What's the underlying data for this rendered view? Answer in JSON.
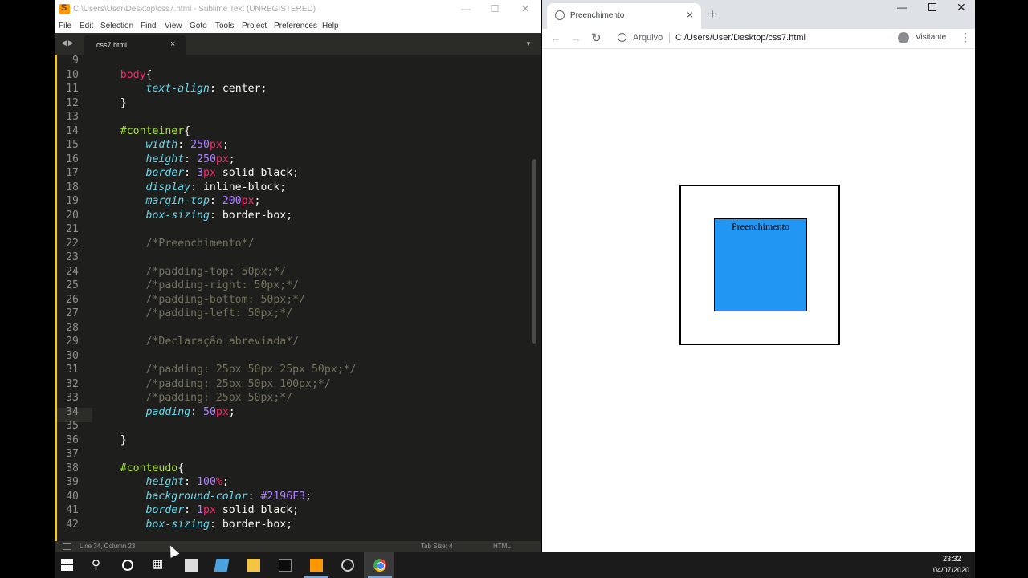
{
  "sublime": {
    "title": "C:\\Users\\User\\Desktop\\css7.html - Sublime Text (UNREGISTERED)",
    "menu": [
      "File",
      "Edit",
      "Selection",
      "Find",
      "View",
      "Goto",
      "Tools",
      "Project",
      "Preferences",
      "Help"
    ],
    "tab": {
      "label": "css7.html",
      "close": "×"
    },
    "status": {
      "position": "Line 34, Column 23",
      "tab_size": "Tab Size: 4",
      "syntax": "HTML"
    },
    "code": [
      {
        "n": "9",
        "parts": []
      },
      {
        "n": "10",
        "parts": [
          {
            "t": "    ",
            "c": ""
          },
          {
            "t": "body",
            "c": "tag"
          },
          {
            "t": "{",
            "c": ""
          }
        ]
      },
      {
        "n": "11",
        "parts": [
          {
            "t": "        ",
            "c": ""
          },
          {
            "t": "text-align",
            "c": "prop"
          },
          {
            "t": ": center;",
            "c": ""
          }
        ]
      },
      {
        "n": "12",
        "parts": [
          {
            "t": "    }",
            "c": ""
          }
        ]
      },
      {
        "n": "13",
        "parts": []
      },
      {
        "n": "14",
        "parts": [
          {
            "t": "    ",
            "c": ""
          },
          {
            "t": "#conteiner",
            "c": "sel"
          },
          {
            "t": "{",
            "c": ""
          }
        ]
      },
      {
        "n": "15",
        "parts": [
          {
            "t": "        ",
            "c": ""
          },
          {
            "t": "width",
            "c": "prop"
          },
          {
            "t": ": ",
            "c": ""
          },
          {
            "t": "250",
            "c": "num"
          },
          {
            "t": "px",
            "c": "unit"
          },
          {
            "t": ";",
            "c": ""
          }
        ]
      },
      {
        "n": "16",
        "parts": [
          {
            "t": "        ",
            "c": ""
          },
          {
            "t": "height",
            "c": "prop"
          },
          {
            "t": ": ",
            "c": ""
          },
          {
            "t": "250",
            "c": "num"
          },
          {
            "t": "px",
            "c": "unit"
          },
          {
            "t": ";",
            "c": ""
          }
        ]
      },
      {
        "n": "17",
        "parts": [
          {
            "t": "        ",
            "c": ""
          },
          {
            "t": "border",
            "c": "prop"
          },
          {
            "t": ": ",
            "c": ""
          },
          {
            "t": "3",
            "c": "num"
          },
          {
            "t": "px",
            "c": "unit"
          },
          {
            "t": " solid black;",
            "c": ""
          }
        ]
      },
      {
        "n": "18",
        "parts": [
          {
            "t": "        ",
            "c": ""
          },
          {
            "t": "display",
            "c": "prop"
          },
          {
            "t": ": inline-block;",
            "c": ""
          }
        ]
      },
      {
        "n": "19",
        "parts": [
          {
            "t": "        ",
            "c": ""
          },
          {
            "t": "margin-top",
            "c": "prop"
          },
          {
            "t": ": ",
            "c": ""
          },
          {
            "t": "200",
            "c": "num"
          },
          {
            "t": "px",
            "c": "unit"
          },
          {
            "t": ";",
            "c": ""
          }
        ]
      },
      {
        "n": "20",
        "parts": [
          {
            "t": "        ",
            "c": ""
          },
          {
            "t": "box-sizing",
            "c": "prop"
          },
          {
            "t": ": border-box;",
            "c": ""
          }
        ]
      },
      {
        "n": "21",
        "parts": []
      },
      {
        "n": "22",
        "parts": [
          {
            "t": "        ",
            "c": ""
          },
          {
            "t": "/*Preenchimento*/",
            "c": "cmt"
          }
        ]
      },
      {
        "n": "23",
        "parts": []
      },
      {
        "n": "24",
        "parts": [
          {
            "t": "        ",
            "c": ""
          },
          {
            "t": "/*padding-top: 50px;*/",
            "c": "cmt"
          }
        ]
      },
      {
        "n": "25",
        "parts": [
          {
            "t": "        ",
            "c": ""
          },
          {
            "t": "/*padding-right: 50px;*/",
            "c": "cmt"
          }
        ]
      },
      {
        "n": "26",
        "parts": [
          {
            "t": "        ",
            "c": ""
          },
          {
            "t": "/*padding-bottom: 50px;*/",
            "c": "cmt"
          }
        ]
      },
      {
        "n": "27",
        "parts": [
          {
            "t": "        ",
            "c": ""
          },
          {
            "t": "/*padding-left: 50px;*/",
            "c": "cmt"
          }
        ]
      },
      {
        "n": "28",
        "parts": []
      },
      {
        "n": "29",
        "parts": [
          {
            "t": "        ",
            "c": ""
          },
          {
            "t": "/*Declaração abreviada*/",
            "c": "cmt"
          }
        ]
      },
      {
        "n": "30",
        "parts": []
      },
      {
        "n": "31",
        "parts": [
          {
            "t": "        ",
            "c": ""
          },
          {
            "t": "/*padding: 25px 50px 25px 50px;*/",
            "c": "cmt"
          }
        ]
      },
      {
        "n": "32",
        "parts": [
          {
            "t": "        ",
            "c": ""
          },
          {
            "t": "/*padding: 25px 50px 100px;*/",
            "c": "cmt"
          }
        ]
      },
      {
        "n": "33",
        "parts": [
          {
            "t": "        ",
            "c": ""
          },
          {
            "t": "/*padding: 25px 50px;*/",
            "c": "cmt"
          }
        ]
      },
      {
        "n": "34",
        "parts": [
          {
            "t": "        ",
            "c": ""
          },
          {
            "t": "padding",
            "c": "prop"
          },
          {
            "t": ": ",
            "c": ""
          },
          {
            "t": "50",
            "c": "num"
          },
          {
            "t": "px",
            "c": "unit"
          },
          {
            "t": ";",
            "c": ""
          }
        ]
      },
      {
        "n": "35",
        "parts": []
      },
      {
        "n": "36",
        "parts": [
          {
            "t": "    }",
            "c": ""
          }
        ]
      },
      {
        "n": "37",
        "parts": []
      },
      {
        "n": "38",
        "parts": [
          {
            "t": "    ",
            "c": ""
          },
          {
            "t": "#conteudo",
            "c": "sel"
          },
          {
            "t": "{",
            "c": ""
          }
        ]
      },
      {
        "n": "39",
        "parts": [
          {
            "t": "        ",
            "c": ""
          },
          {
            "t": "height",
            "c": "prop"
          },
          {
            "t": ": ",
            "c": ""
          },
          {
            "t": "100",
            "c": "num"
          },
          {
            "t": "%",
            "c": "unit"
          },
          {
            "t": ";",
            "c": ""
          }
        ]
      },
      {
        "n": "40",
        "parts": [
          {
            "t": "        ",
            "c": ""
          },
          {
            "t": "background-color",
            "c": "prop"
          },
          {
            "t": ": ",
            "c": ""
          },
          {
            "t": "#2196F3",
            "c": "num"
          },
          {
            "t": ";",
            "c": ""
          }
        ]
      },
      {
        "n": "41",
        "parts": [
          {
            "t": "        ",
            "c": ""
          },
          {
            "t": "border",
            "c": "prop"
          },
          {
            "t": ": ",
            "c": ""
          },
          {
            "t": "1",
            "c": "num"
          },
          {
            "t": "px",
            "c": "unit"
          },
          {
            "t": " solid black;",
            "c": ""
          }
        ]
      },
      {
        "n": "42",
        "parts": [
          {
            "t": "        ",
            "c": ""
          },
          {
            "t": "box-sizing",
            "c": "prop"
          },
          {
            "t": ": border-box;",
            "c": ""
          }
        ]
      }
    ]
  },
  "chrome": {
    "tab_title": "Preenchimento",
    "tab_close": "×",
    "new_tab": "+",
    "scheme_label": "Arquivo",
    "url": "C:/Users/User/Desktop/css7.html",
    "profile": "Visitante",
    "page": {
      "content_text": "Preenchimento",
      "content_color": "#2196F3"
    }
  },
  "taskbar": {
    "time": "23:32",
    "date": "04/07/2020"
  }
}
